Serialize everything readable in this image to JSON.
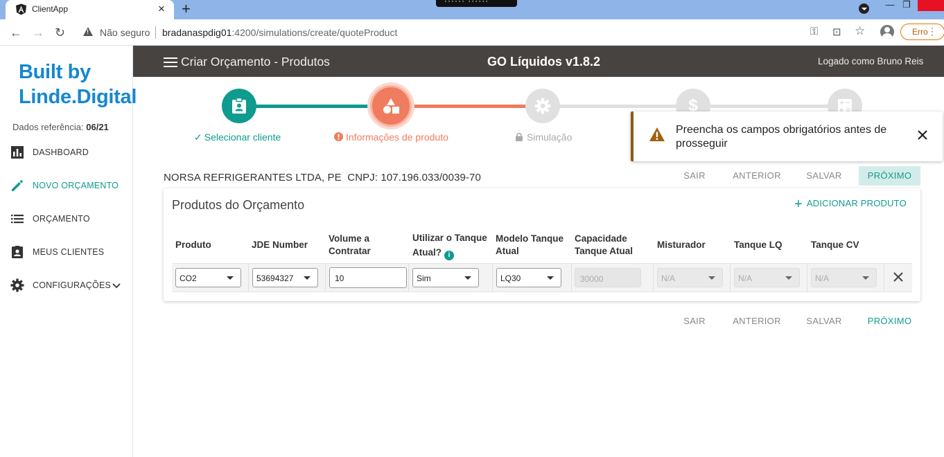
{
  "browser": {
    "tab_title": "ClientApp",
    "security_label": "Não seguro",
    "url_host": "bradanaspdig01",
    "url_rest": ":4200/simulations/create/quoteProduct",
    "profile_button": "Erro"
  },
  "sidebar": {
    "brand_line1": "Built by",
    "brand_line2": "Linde.Digital",
    "ref_label": "Dados referência:",
    "ref_value": "06/21",
    "items": [
      {
        "label": "DASHBOARD",
        "icon": "bar-chart-icon"
      },
      {
        "label": "NOVO ORÇAMENTO",
        "icon": "pencil-icon",
        "active": true
      },
      {
        "label": "ORÇAMENTO",
        "icon": "list-icon"
      },
      {
        "label": "MEUS CLIENTES",
        "icon": "contact-card-icon"
      },
      {
        "label": "CONFIGURAÇÕES",
        "icon": "gear-icon"
      }
    ]
  },
  "appbar": {
    "title": "Criar Orçamento - Produtos",
    "app_name": "GO Líquidos v1.8.2",
    "user": "Logado como Bruno Reis"
  },
  "stepper": {
    "steps": [
      {
        "label": "Selecionar cliente",
        "state": "done"
      },
      {
        "label": "Informações de produto",
        "state": "error"
      },
      {
        "label": "Simulação",
        "state": "locked"
      }
    ]
  },
  "toast": {
    "message": "Preencha os campos obrigatórios antes de prosseguir"
  },
  "client": {
    "name": "NORSA REFRIGERANTES LTDA, PE",
    "cnpj": "CNPJ: 107.196.033/0039-70"
  },
  "actions": {
    "exit": "SAIR",
    "previous": "ANTERIOR",
    "save": "SALVAR",
    "next": "PRÓXIMO"
  },
  "products": {
    "title": "Produtos do Orçamento",
    "add_label": "ADICIONAR PRODUTO",
    "headers": {
      "produto": "Produto",
      "jde": "JDE Number",
      "volume_1": "Volume a",
      "volume_2": "Contratar",
      "tanque_1": "Utilizar o Tanque",
      "tanque_2": "Atual?",
      "modelo_1": "Modelo Tanque",
      "modelo_2": "Atual",
      "capacidade_1": "Capacidade",
      "capacidade_2": "Tanque Atual",
      "misturador": "Misturador",
      "tanque_lq": "Tanque LQ",
      "tanque_cv": "Tanque CV"
    },
    "row": {
      "produto": "CO2",
      "jde": "53694327",
      "volume": "10",
      "usar_tanque": "Sim",
      "modelo": "LQ30",
      "capacidade": "30000",
      "misturador": "N/A",
      "tanque_lq": "N/A",
      "tanque_cv": "N/A"
    }
  },
  "colors": {
    "teal": "#0f9b8e",
    "coral": "#ef7c5e",
    "appbar": "#474340",
    "brand_blue": "#1687d0",
    "toast_border": "#8a5d14"
  }
}
